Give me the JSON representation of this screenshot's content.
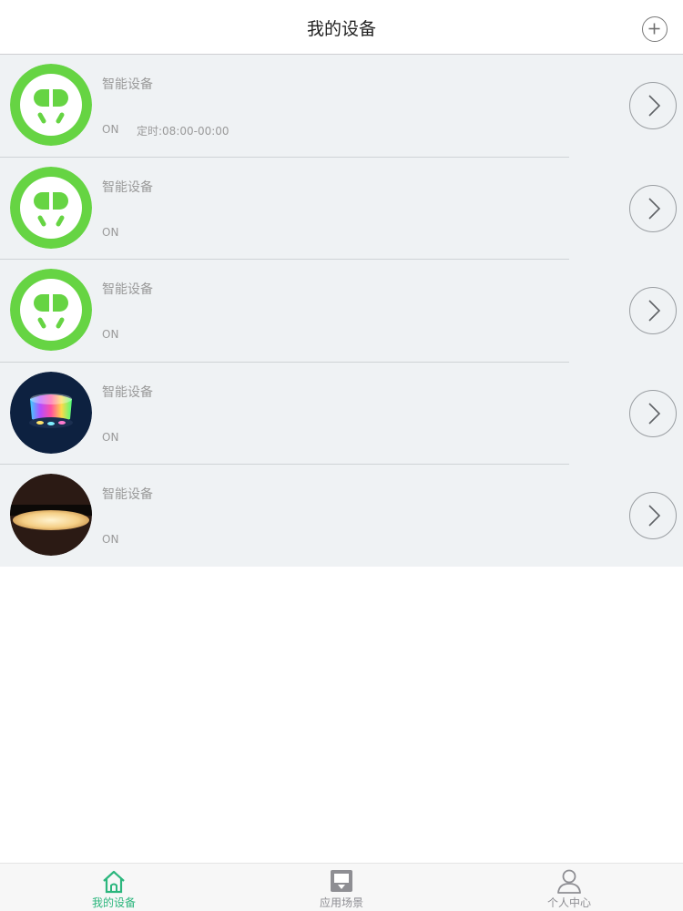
{
  "header": {
    "title": "我的设备",
    "add_icon": "plus-circle-icon"
  },
  "devices": [
    {
      "name": "智能设备",
      "state": "ON",
      "timer": "定时:08:00-00:00",
      "icon": "smart-plug-icon",
      "accent": "#66d443"
    },
    {
      "name": "智能设备",
      "state": "ON",
      "timer": "",
      "icon": "smart-plug-icon",
      "accent": "#66d443"
    },
    {
      "name": "智能设备",
      "state": "ON",
      "timer": "",
      "icon": "smart-plug-icon",
      "accent": "#66d443"
    },
    {
      "name": "智能设备",
      "state": "ON",
      "timer": "",
      "icon": "rgb-light-icon",
      "accent": "#0d2140"
    },
    {
      "name": "智能设备",
      "state": "ON",
      "timer": "",
      "icon": "ceiling-lamp-icon",
      "accent": "#2b1a14"
    }
  ],
  "tabbar": {
    "tabs": [
      {
        "label": "我的设备",
        "icon": "home-icon",
        "active": true
      },
      {
        "label": "应用场景",
        "icon": "scene-icon",
        "active": false
      },
      {
        "label": "个人中心",
        "icon": "user-icon",
        "active": false
      }
    ],
    "active_color": "#2cb67d",
    "inactive_color": "#8e8e93"
  }
}
